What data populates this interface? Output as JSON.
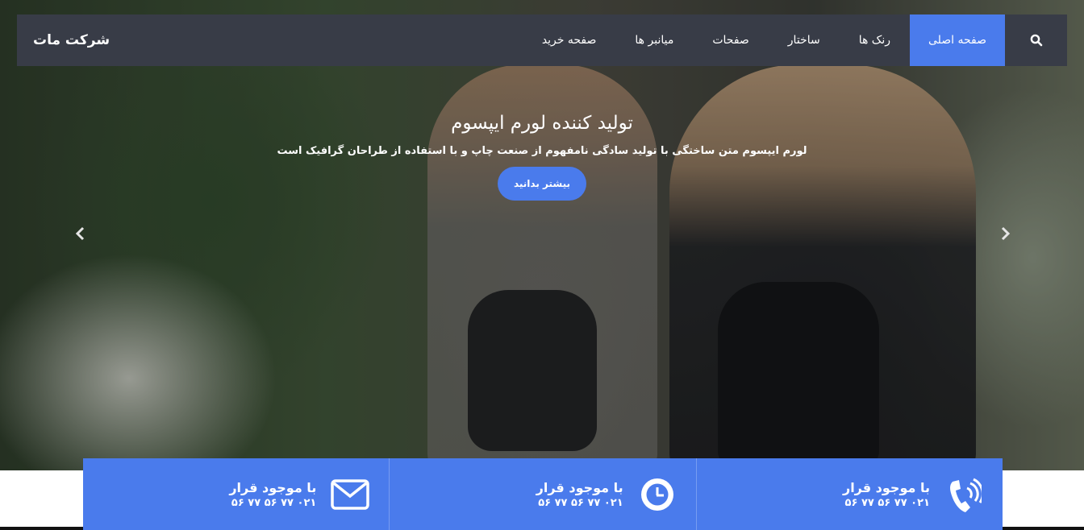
{
  "brand": "شرکت مات",
  "nav": {
    "items": [
      "صفحه اصلی",
      "رنک ها",
      "ساختار",
      "صفحات",
      "میانبر ها",
      "صفحه خرید"
    ],
    "active_index": 0
  },
  "hero": {
    "title": "تولید کننده لورم ایپسوم",
    "subtitle": "لورم ایپسوم متن ساختگی با تولید سادگی نامفهوم از صنعت چاپ و با استفاده از طراحان گرافیک است",
    "button_label": "بیشتر بدانید"
  },
  "info": [
    {
      "icon": "envelope-icon",
      "title": "با موجود قرار",
      "sub": "۰۲۱ ۷۷ ۵۶ ۷۷ ۵۶"
    },
    {
      "icon": "clock-icon",
      "title": "با موجود قرار",
      "sub": "۰۲۱ ۷۷ ۵۶ ۷۷ ۵۶"
    },
    {
      "icon": "phone-icon",
      "title": "با موجود قرار",
      "sub": "۰۲۱ ۷۷ ۵۶ ۷۷ ۵۶"
    }
  ],
  "colors": {
    "accent": "#4a7bec",
    "navbar": "#383c47"
  }
}
